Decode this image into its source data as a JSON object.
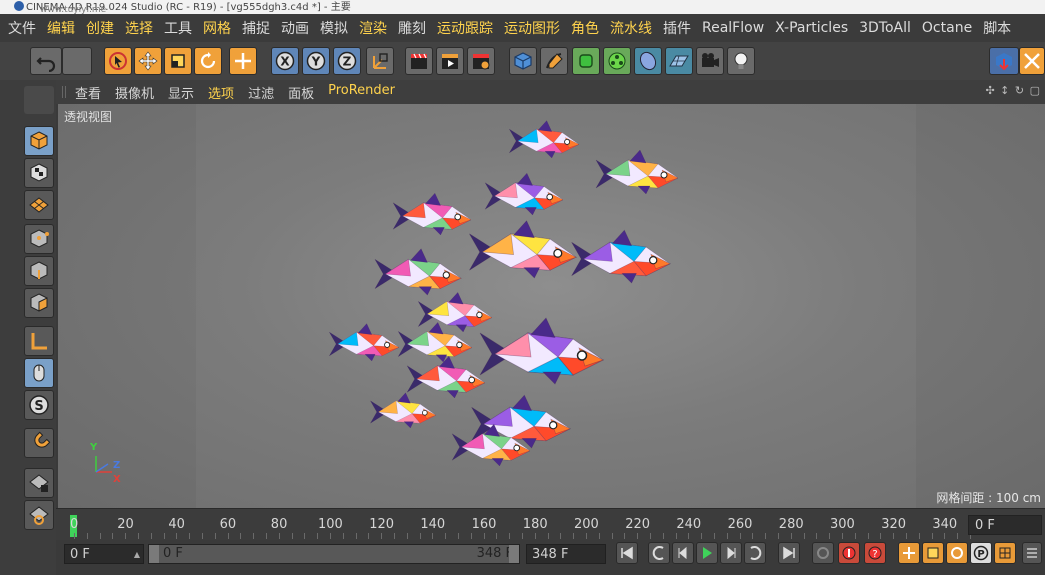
{
  "window": {
    "title": "CINEMA 4D R19.024 Studio (RC - R19) - [vg555dgh3.c4d *] - 主要",
    "watermark": "www.tuyiyi.me"
  },
  "menu": {
    "items": [
      {
        "label": "文件",
        "accent": false
      },
      {
        "label": "编辑",
        "accent": true
      },
      {
        "label": "创建",
        "accent": true
      },
      {
        "label": "选择",
        "accent": true
      },
      {
        "label": "工具",
        "accent": false
      },
      {
        "label": "网格",
        "accent": true
      },
      {
        "label": "捕捉",
        "accent": false
      },
      {
        "label": "动画",
        "accent": false
      },
      {
        "label": "模拟",
        "accent": false
      },
      {
        "label": "渲染",
        "accent": true
      },
      {
        "label": "雕刻",
        "accent": false
      },
      {
        "label": "运动跟踪",
        "accent": true
      },
      {
        "label": "运动图形",
        "accent": true
      },
      {
        "label": "角色",
        "accent": true
      },
      {
        "label": "流水线",
        "accent": true
      },
      {
        "label": "插件",
        "accent": false
      },
      {
        "label": "RealFlow",
        "accent": false
      },
      {
        "label": "X-Particles",
        "accent": false
      },
      {
        "label": "3DToAll",
        "accent": false
      },
      {
        "label": "Octane",
        "accent": false
      },
      {
        "label": "脚本",
        "accent": false
      }
    ]
  },
  "toolbar": {
    "axis_x": "X",
    "axis_y": "Y",
    "axis_z": "Z"
  },
  "viewport_menu": {
    "items": [
      {
        "label": "查看",
        "hl": false
      },
      {
        "label": "摄像机",
        "hl": false
      },
      {
        "label": "显示",
        "hl": false
      },
      {
        "label": "选项",
        "hl": true
      },
      {
        "label": "过滤",
        "hl": false
      },
      {
        "label": "面板",
        "hl": false
      },
      {
        "label": "ProRender",
        "hl": true
      }
    ],
    "nav_icons": "✣ ↕ ↻ ▢"
  },
  "viewport": {
    "label": "透视视图",
    "grid_spacing": "网格间距 : 100 cm",
    "axes": {
      "y": "Y",
      "z": "Z",
      "x": "X"
    }
  },
  "timeline": {
    "ticks": [
      "0",
      "20",
      "40",
      "60",
      "80",
      "100",
      "120",
      "140",
      "160",
      "180",
      "200",
      "220",
      "240",
      "260",
      "280",
      "300",
      "320",
      "340"
    ],
    "current_frame": "0 F"
  },
  "playback": {
    "start_field": "0 F",
    "range_start": "0 F",
    "range_end": "348 F",
    "end_field": "348 F",
    "min_frame": 0,
    "max_frame": 348
  },
  "colors": {
    "accent_menu": "#ffd34d",
    "playhead": "#3fd35a",
    "tool_orange": "#f0a13a",
    "axis_x": "#e0413a",
    "axis_y": "#3fcf3f",
    "axis_z": "#4a7ae0"
  }
}
